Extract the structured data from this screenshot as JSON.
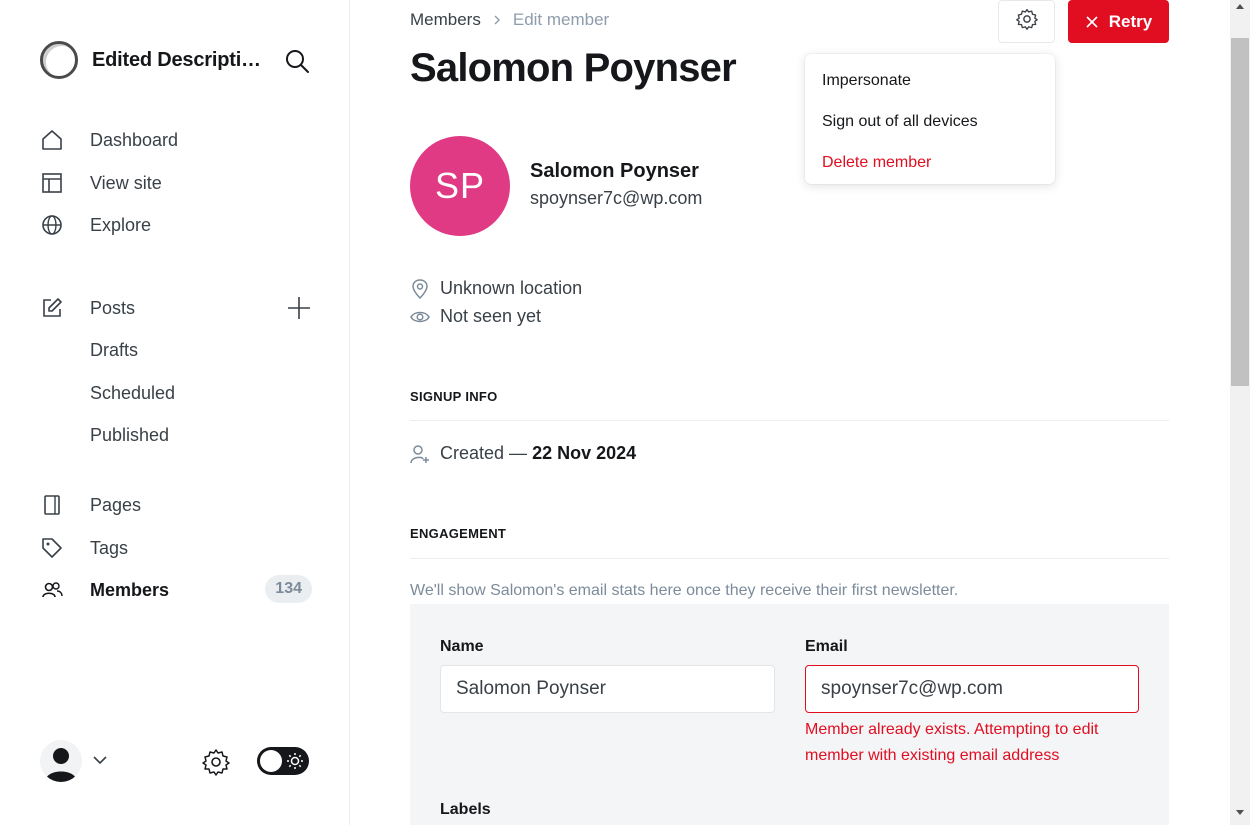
{
  "sidebar": {
    "brand": {
      "name": "Edited Descripti…",
      "logo_icon": "circle-logo-icon",
      "search_icon": "search-icon"
    },
    "nav_top": [
      {
        "label": "Dashboard",
        "icon": "home-icon"
      },
      {
        "label": "View site",
        "icon": "layout-icon"
      },
      {
        "label": "Explore",
        "icon": "globe-icon"
      }
    ],
    "posts": {
      "label": "Posts",
      "icon": "pencil-icon",
      "add_icon": "plus-icon"
    },
    "post_subs": [
      "Drafts",
      "Scheduled",
      "Published"
    ],
    "nav_bottom": [
      {
        "label": "Pages",
        "icon": "page-icon"
      },
      {
        "label": "Tags",
        "icon": "tag-icon"
      }
    ],
    "members": {
      "label": "Members",
      "icon": "users-icon",
      "count": "134",
      "active": true
    }
  },
  "header": {
    "breadcrumb": {
      "parent": "Members",
      "current": "Edit member"
    },
    "title": "Salomon Poynser",
    "retry_label": "Retry"
  },
  "menu": {
    "items": [
      "Impersonate",
      "Sign out of all devices",
      "Delete member"
    ]
  },
  "member": {
    "initials": "SP",
    "name": "Salomon Poynser",
    "email": "spoynser7c@wp.com",
    "avatar_color": "#e03a84",
    "location": "Unknown location",
    "seen": "Not seen yet"
  },
  "signup": {
    "heading": "SIGNUP INFO",
    "created_prefix": "Created —",
    "created_date": "22 Nov 2024"
  },
  "engagement": {
    "heading": "ENGAGEMENT",
    "note": "We'll show Salomon's email stats here once they receive their first newsletter."
  },
  "form": {
    "name_label": "Name",
    "name_value": "Salomon Poynser",
    "email_label": "Email",
    "email_value": "spoynser7c@wp.com",
    "email_error_line1": "Member already exists. Attempting to edit",
    "email_error_line2": "member with existing email address",
    "labels_label": "Labels"
  },
  "colors": {
    "accent_red": "#e10e22",
    "avatar_pink": "#e03a84"
  }
}
